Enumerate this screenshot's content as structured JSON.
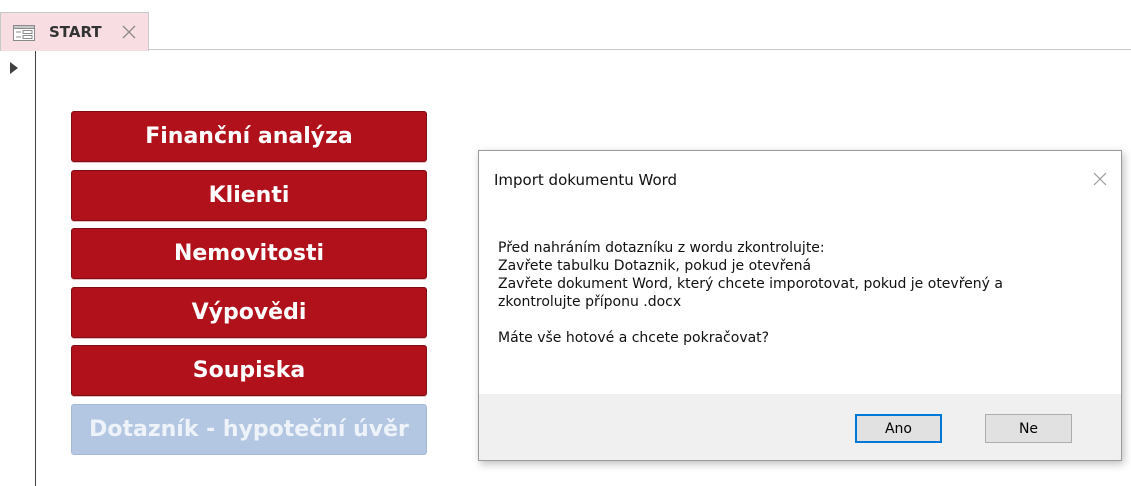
{
  "tab": {
    "label": "START",
    "icon": "form-icon",
    "close_icon": "close-icon",
    "accent": "#f8dde3"
  },
  "nav_buttons": [
    {
      "label": "Finanční analýza",
      "enabled": true
    },
    {
      "label": "Klienti",
      "enabled": true
    },
    {
      "label": "Nemovitosti",
      "enabled": true
    },
    {
      "label": "Výpovědi",
      "enabled": true
    },
    {
      "label": "Soupiska",
      "enabled": true
    },
    {
      "label": "Dotazník - hypoteční úvěr",
      "enabled": false
    }
  ],
  "colors": {
    "button": "#b1111b",
    "button_disabled": "#b3c7e2",
    "dialog_default_border": "#0078d7"
  },
  "dialog": {
    "title": "Import dokumentu Word",
    "lines": [
      "Před nahráním dotazníku z wordu zkontrolujte:",
      "Zavřete tabulku Dotaznik, pokud je otevřená",
      "Zavřete dokument Word, který chcete imporotovat, pokud je otevřený a",
      "zkontrolujte příponu .docx"
    ],
    "question": "Máte vše hotové a chcete pokračovat?",
    "yes_label": "Ano",
    "no_label": "Ne"
  }
}
